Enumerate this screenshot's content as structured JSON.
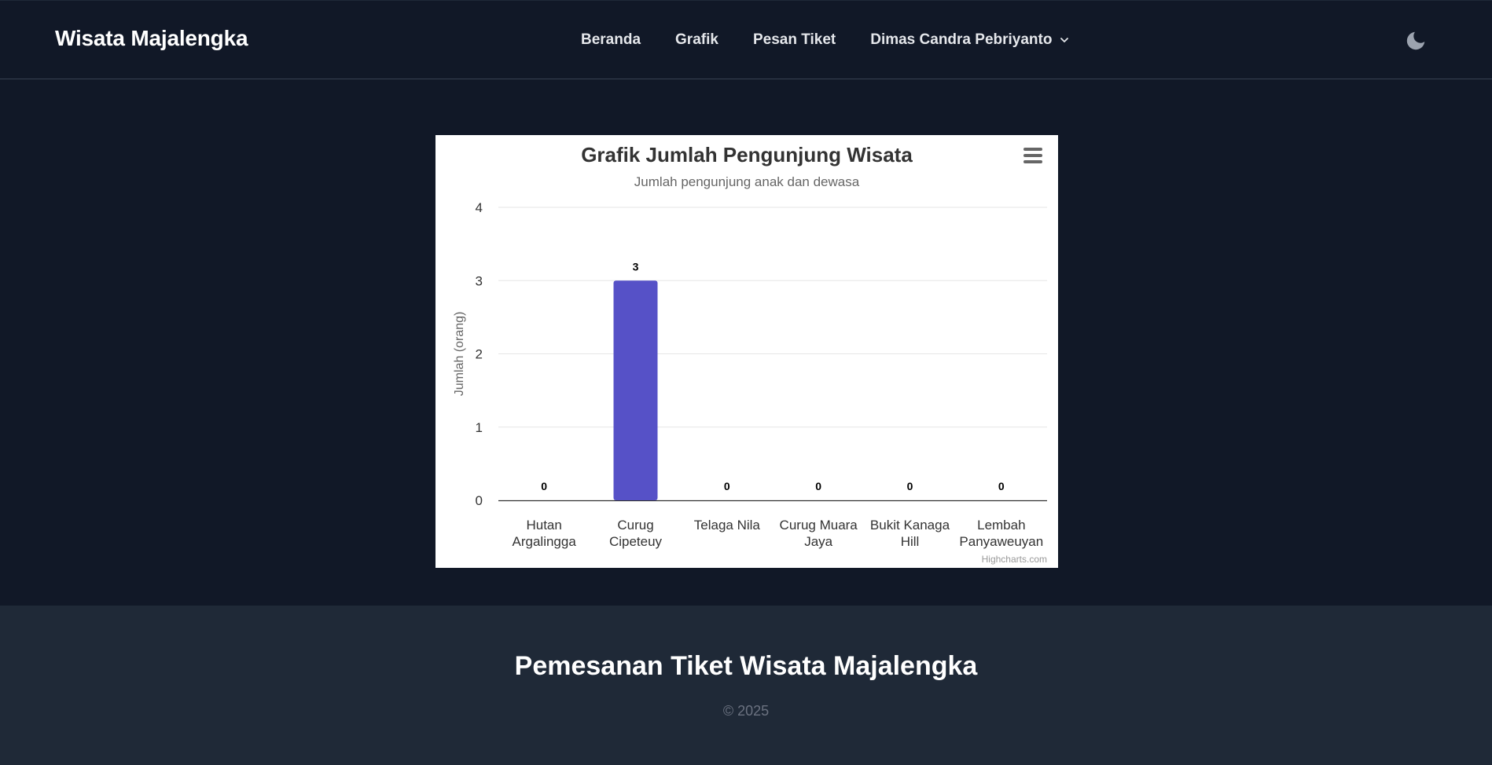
{
  "navbar": {
    "brand": "Wisata Majalengka",
    "links": [
      {
        "label": "Beranda"
      },
      {
        "label": "Grafik"
      },
      {
        "label": "Pesan Tiket"
      }
    ],
    "user_menu": "Dimas Candra Pebriyanto",
    "theme_icon": "moon-icon"
  },
  "chart": {
    "menu_icon": "hamburger-menu-icon",
    "credits": "Highcharts.com"
  },
  "chart_data": {
    "type": "bar",
    "title": "Grafik Jumlah Pengunjung Wisata",
    "subtitle": "Jumlah pengunjung anak dan dewasa",
    "xlabel": "",
    "ylabel": "Jumlah (orang)",
    "categories": [
      [
        "Hutan",
        "Argalingga"
      ],
      [
        "Curug",
        "Cipeteuy"
      ],
      [
        "Telaga Nila"
      ],
      [
        "Curug Muara",
        "Jaya"
      ],
      [
        "Bukit Kanaga",
        "Hill"
      ],
      [
        "Lembah",
        "Panyaweuyan"
      ]
    ],
    "values": [
      0,
      3,
      0,
      0,
      0,
      0
    ],
    "ylim": [
      0,
      4
    ],
    "yticks": [
      0,
      1,
      2,
      3,
      4
    ],
    "grid": true,
    "bar_color": "#5651c7"
  },
  "footer": {
    "title": "Pemesanan Tiket Wisata Majalengka",
    "copyright": "© 2025"
  }
}
